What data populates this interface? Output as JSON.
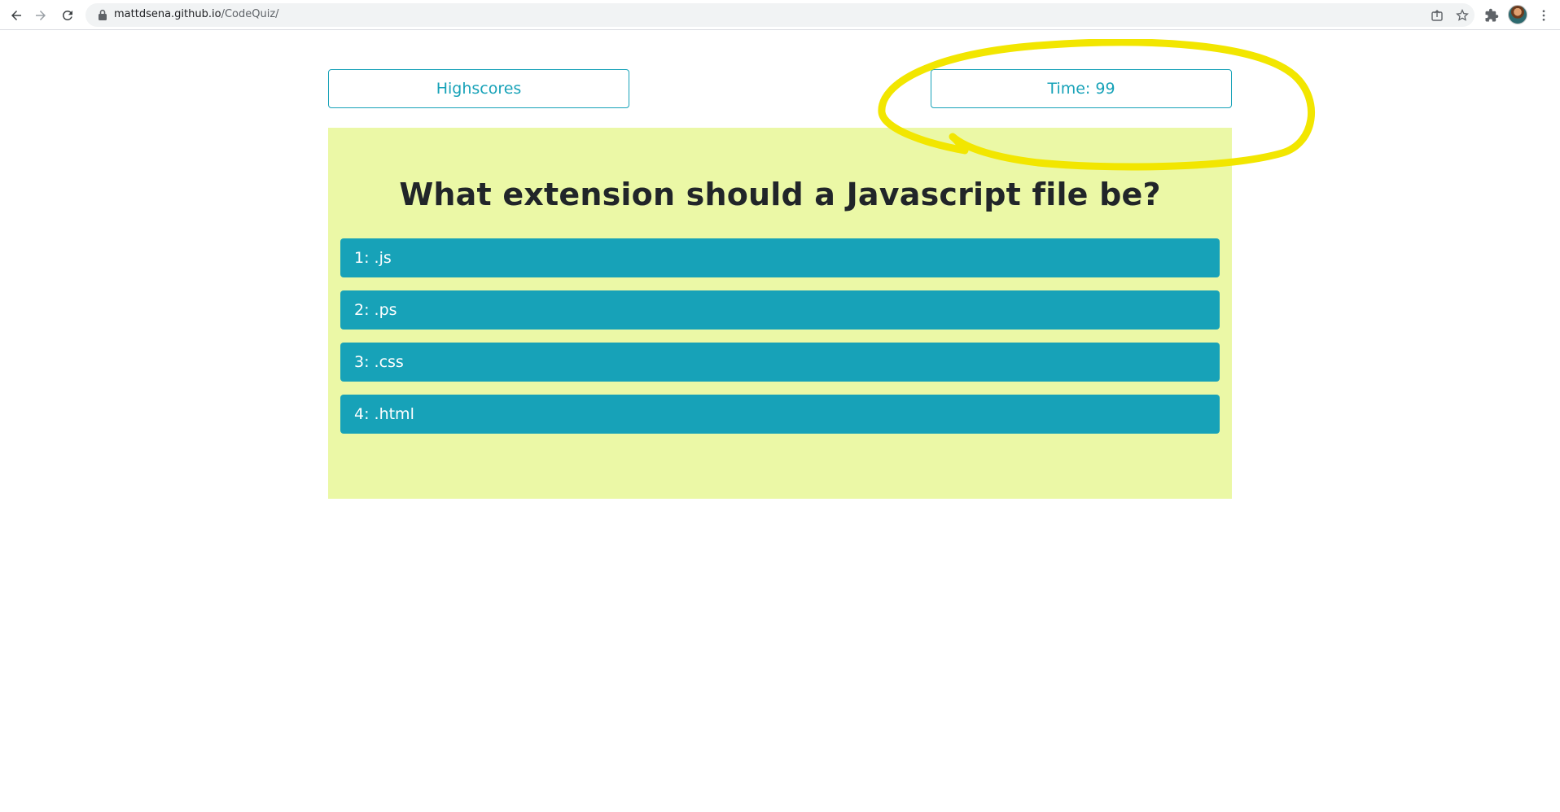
{
  "browser": {
    "url_host": "mattdsena.github.io",
    "url_path": "/CodeQuiz/",
    "icons": {
      "back": "arrow-left-icon",
      "forward": "arrow-right-icon",
      "reload": "reload-icon",
      "lock": "lock-icon",
      "share": "share-icon",
      "bookmark": "star-icon",
      "extensions": "puzzle-icon",
      "profile": "avatar",
      "menu": "kebab-menu-icon"
    }
  },
  "header": {
    "highscores_label": "Highscores",
    "timer_label": "Time: 99"
  },
  "quiz": {
    "question": "What extension should a Javascript file be?",
    "answers": [
      {
        "label": "1: .js"
      },
      {
        "label": "2: .ps"
      },
      {
        "label": "3: .css"
      },
      {
        "label": "4: .html"
      }
    ]
  },
  "colors": {
    "accent": "#17a2b8",
    "card_background": "#ebf8a6",
    "highlight_annotation": "#f2e600",
    "question_text": "#212529"
  }
}
